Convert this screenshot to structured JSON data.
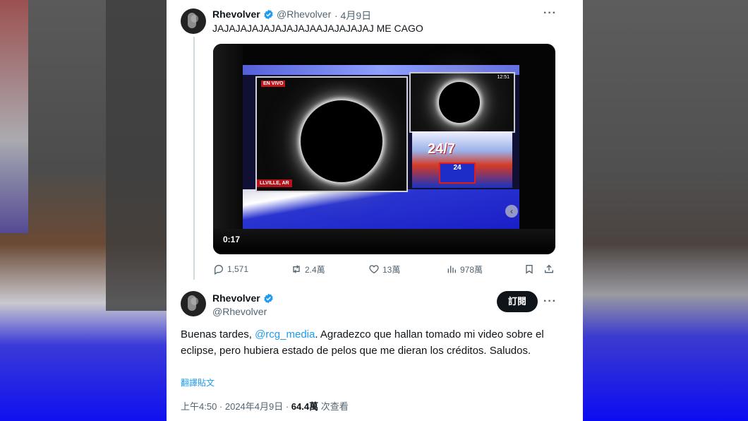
{
  "tweet1": {
    "name": "Rhevolver",
    "handle": "@Rhevolver",
    "date": "· 4月9日",
    "text": "JAJAJAJAJAJAJAJAJAAJAJAJAJAJ ME CAGO",
    "more": "···",
    "video": {
      "duration": "0:17",
      "live_label": "EN VIVO",
      "location_label": "LLVILLE, AR",
      "clock": "12:51",
      "channel_logo": "24/7",
      "panel_logo": "24"
    },
    "actions": {
      "replies": "1,571",
      "retweets": "2.4萬",
      "likes": "13萬",
      "views": "978萬"
    }
  },
  "tweet2": {
    "name": "Rhevolver",
    "handle": "@Rhevolver",
    "subscribe_label": "訂閱",
    "more": "···",
    "text_before": "Buenas tardes, ",
    "mention": "@rcg_media",
    "text_after": ". Agradezco que hallan tomado mi video sobre el eclipse, pero hubiera estado de pelos que me dieran los créditos. Saludos.",
    "translate_label": "翻譯貼文",
    "time": "上午4:50 · 2024年4月9日 · ",
    "views_count": "64.4萬",
    "views_label": " 次查看"
  },
  "colors": {
    "accent": "#1d9bf0",
    "text": "#0f1419",
    "secondary": "#536471"
  }
}
